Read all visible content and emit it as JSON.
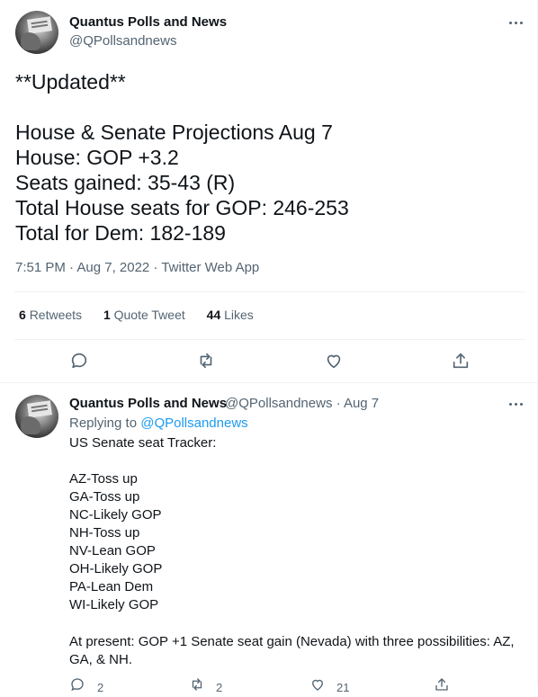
{
  "main_tweet": {
    "author_name": "Quantus Polls and News",
    "author_handle": "@QPollsandnews",
    "lines": [
      "**Updated**",
      "",
      "House & Senate Projections Aug 7",
      "House: GOP +3.2",
      "Seats gained: 35-43 (R)",
      "Total House seats for GOP: 246-253",
      "Total for Dem: 182-189"
    ],
    "meta": "7:51 PM · Aug 7, 2022 · Twitter Web App",
    "stats": {
      "retweets_count": "6",
      "retweets_label": "Retweets",
      "quotes_count": "1",
      "quotes_label": "Quote Tweet",
      "likes_count": "44",
      "likes_label": "Likes"
    }
  },
  "reply_tweet": {
    "author_name": "Quantus Polls and News",
    "handle_date": "@QPollsandnews · Aug 7",
    "replying_prefix": "Replying to ",
    "replying_to": "@QPollsandnews",
    "heading": "US Senate seat Tracker:",
    "items": [
      "AZ-Toss up",
      "GA-Toss up",
      "NC-Likely GOP",
      "NH-Toss up",
      "NV-Lean GOP",
      "OH-Likely GOP",
      "PA-Lean Dem",
      "WI-Likely GOP"
    ],
    "summary": "At present: GOP +1 Senate seat gain (Nevada) with three possibilities: AZ, GA, & NH.",
    "counts": {
      "reply": "2",
      "retweet": "2",
      "like": "21"
    }
  },
  "colors": {
    "text": "#0f1419",
    "muted": "#536471",
    "link": "#1d9bf0",
    "divider": "#eff3f4"
  }
}
